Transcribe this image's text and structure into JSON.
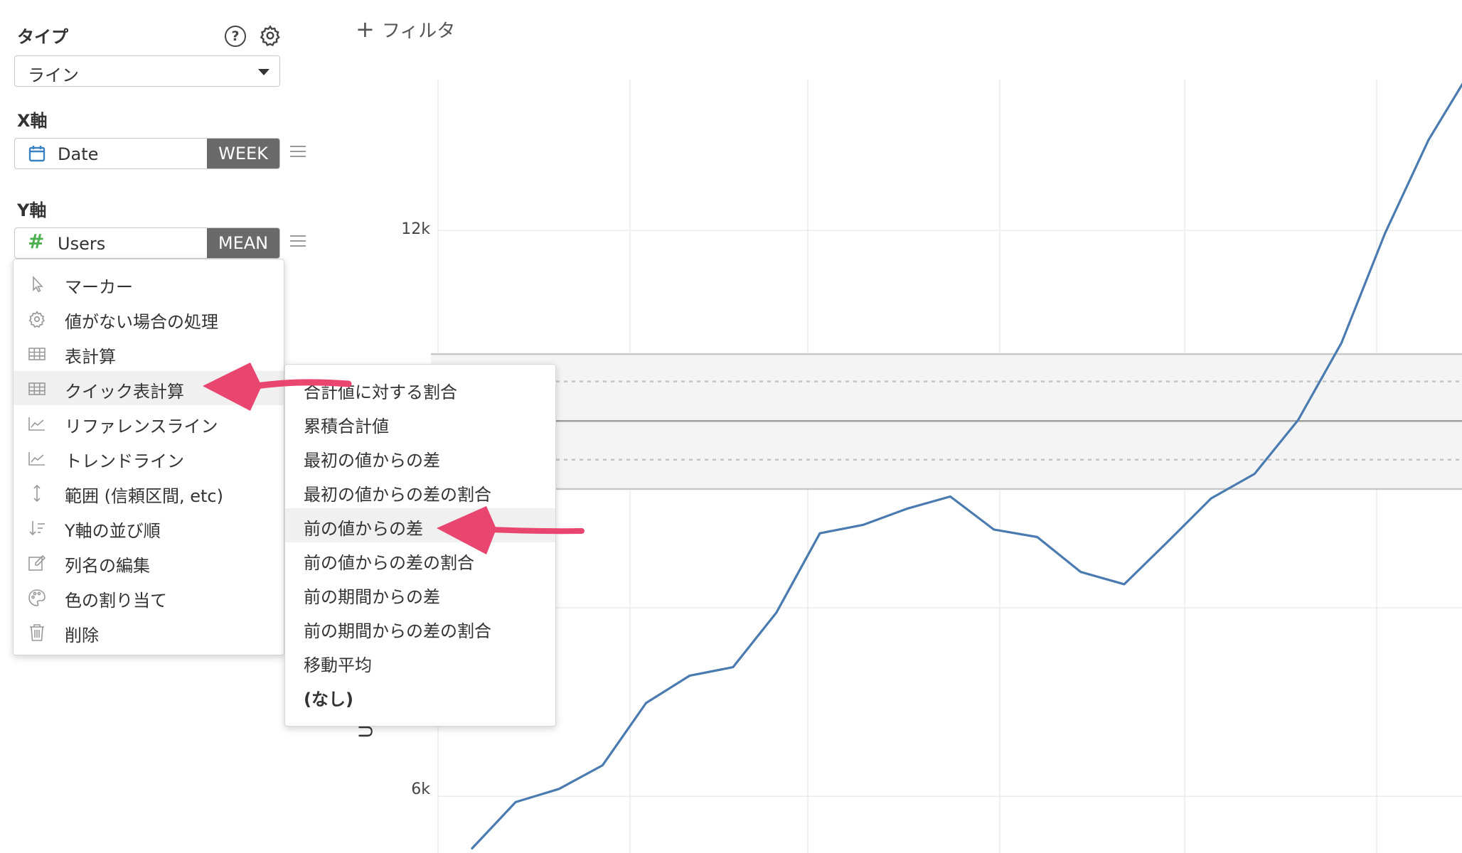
{
  "panel": {
    "type_label": "タイプ",
    "type_value": "ライン",
    "x_axis_label": "X軸",
    "x_field": "Date",
    "x_agg": "WEEK",
    "y_axis_label": "Y軸",
    "y_field": "Users",
    "y_agg": "MEAN",
    "help_glyph": "?"
  },
  "toolbar": {
    "add_filter_label": "フィルタ",
    "add_glyph": "+"
  },
  "context_menu": {
    "items": [
      {
        "label": "マーカー",
        "icon": "cursor-icon"
      },
      {
        "label": "値がない場合の処理",
        "icon": "gear-icon"
      },
      {
        "label": "表計算",
        "icon": "table-icon"
      },
      {
        "label": "クイック表計算",
        "icon": "table-icon",
        "highlighted": true
      },
      {
        "label": "リファレンスライン",
        "icon": "line-chart-icon"
      },
      {
        "label": "トレンドライン",
        "icon": "line-chart-icon"
      },
      {
        "label": "範囲 (信頼区間, etc)",
        "icon": "vertical-arrows-icon"
      },
      {
        "label": "Y軸の並び順",
        "icon": "sort-icon"
      },
      {
        "label": "列名の編集",
        "icon": "edit-icon"
      },
      {
        "label": "色の割り当て",
        "icon": "palette-icon"
      },
      {
        "label": "削除",
        "icon": "trash-icon"
      }
    ]
  },
  "submenu": {
    "items": [
      {
        "label": "合計値に対する割合"
      },
      {
        "label": "累積合計値"
      },
      {
        "label": "最初の値からの差"
      },
      {
        "label": "最初の値からの差の割合"
      },
      {
        "label": "前の値からの差",
        "highlighted": true
      },
      {
        "label": "前の値からの差の割合"
      },
      {
        "label": "前の期間からの差"
      },
      {
        "label": "前の期間からの差の割合"
      },
      {
        "label": "移動平均"
      },
      {
        "label": "(なし)",
        "bold": true
      }
    ]
  },
  "colors": {
    "line": "#4a7bb0",
    "arrow": "#e8466f",
    "agg_bg": "#6a6a6a",
    "calendar": "#3b82c4",
    "hash": "#4caf50"
  },
  "chart_data": {
    "type": "line",
    "y_ticks": [
      "12k",
      "6k"
    ],
    "y_tick_values": [
      12000,
      6000
    ],
    "ylim": [
      5400,
      13600
    ],
    "partial_axis_glyph": "U",
    "reference_band": {
      "outer": [
        9260,
        10690
      ],
      "inner": [
        9980
      ],
      "dotted": [
        9570,
        10400
      ]
    },
    "series": [
      {
        "values": [
          5450,
          5940,
          6080,
          6330,
          6990,
          7280,
          7370,
          7950,
          8790,
          8880,
          9050,
          9180,
          8830,
          8750,
          8380,
          8250,
          8700,
          9160,
          9420,
          9990,
          10810,
          11970,
          12960,
          13720
        ]
      }
    ]
  }
}
